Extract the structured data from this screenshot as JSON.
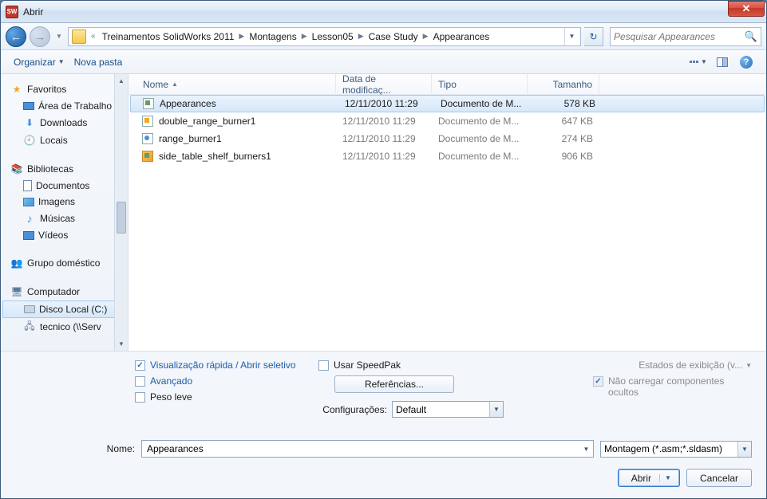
{
  "window": {
    "title": "Abrir",
    "app_icon_text": "SW"
  },
  "nav": {
    "breadcrumb_prefix": "«",
    "crumbs": [
      "Treinamentos SolidWorks 2011",
      "Montagens",
      "Lesson05",
      "Case Study",
      "Appearances"
    ],
    "search_placeholder": "Pesquisar Appearances"
  },
  "toolbar": {
    "organize": "Organizar",
    "new_folder": "Nova pasta"
  },
  "sidebar": {
    "favorites": {
      "title": "Favoritos",
      "items": [
        "Área de Trabalho",
        "Downloads",
        "Locais"
      ]
    },
    "libraries": {
      "title": "Bibliotecas",
      "items": [
        "Documentos",
        "Imagens",
        "Músicas",
        "Vídeos"
      ]
    },
    "homegroup": {
      "title": "Grupo doméstico"
    },
    "computer": {
      "title": "Computador",
      "items": [
        "Disco Local (C:)",
        "tecnico (\\\\Serv"
      ]
    }
  },
  "columns": {
    "name": "Nome",
    "date": "Data de modificaç...",
    "type": "Tipo",
    "size": "Tamanho"
  },
  "files": [
    {
      "name": "Appearances",
      "date": "12/11/2010 11:29",
      "type": "Documento de M...",
      "size": "578 KB",
      "selected": true
    },
    {
      "name": "double_range_burner1",
      "date": "12/11/2010 11:29",
      "type": "Documento de M...",
      "size": "647 KB",
      "selected": false
    },
    {
      "name": "range_burner1",
      "date": "12/11/2010 11:29",
      "type": "Documento de M...",
      "size": "274 KB",
      "selected": false
    },
    {
      "name": "side_table_shelf_burners1",
      "date": "12/11/2010 11:29",
      "type": "Documento de M...",
      "size": "906 KB",
      "selected": false
    }
  ],
  "options": {
    "quick_view": "Visualização rápida / Abrir seletivo",
    "advanced": "Avançado",
    "lightweight": "Peso leve",
    "speedpak": "Usar SpeedPak",
    "references": "Referências...",
    "config_label": "Configurações:",
    "config_value": "Default",
    "display_states": "Estados de exibição (v...",
    "no_hidden": "Não carregar componentes ocultos"
  },
  "filename": {
    "label": "Nome:",
    "value": "Appearances"
  },
  "filter": {
    "value": "Montagem (*.asm;*.sldasm)"
  },
  "buttons": {
    "open": "Abrir",
    "cancel": "Cancelar"
  }
}
